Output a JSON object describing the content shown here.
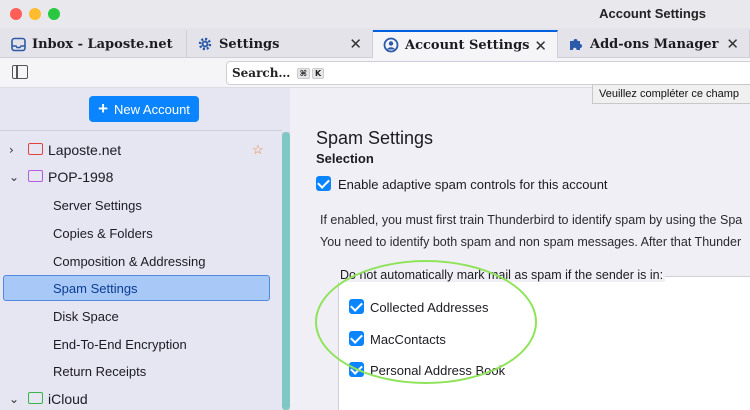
{
  "window": {
    "title": "Account Settings"
  },
  "tabs": [
    {
      "label": "Inbox - Laposte.net",
      "icon": "inbox-icon",
      "closable": false,
      "active": false
    },
    {
      "label": "Settings",
      "icon": "gear-icon",
      "closable": true,
      "active": false
    },
    {
      "label": "Account Settings",
      "icon": "account-settings-icon",
      "closable": true,
      "active": true
    },
    {
      "label": "Add-ons Manager",
      "icon": "puzzle-icon",
      "closable": true,
      "active": false
    }
  ],
  "toolbar": {
    "search_placeholder": "Search…",
    "shortcut_keys": [
      "⌘",
      "K"
    ],
    "tooltip": "Veuillez compléter ce champ"
  },
  "sidebar": {
    "new_account_label": "New Account",
    "accounts": [
      {
        "label": "Laposte.net",
        "expanded": false,
        "starred": true,
        "icon_color": "#e0443e"
      },
      {
        "label": "POP-1998",
        "expanded": true,
        "starred": false,
        "icon_color": "#b45be0",
        "items": [
          {
            "label": "Server Settings"
          },
          {
            "label": "Copies & Folders"
          },
          {
            "label": "Composition & Addressing"
          },
          {
            "label": "Spam Settings",
            "selected": true
          },
          {
            "label": "Disk Space"
          },
          {
            "label": "End-To-End Encryption"
          },
          {
            "label": "Return Receipts"
          }
        ]
      },
      {
        "label": "iCloud",
        "expanded": true,
        "starred": false,
        "icon_color": "#3bb54a"
      }
    ]
  },
  "main": {
    "title": "Spam Settings",
    "section": "Selection",
    "adaptive_checkbox": {
      "label": "Enable adaptive spam controls for this account",
      "checked": true
    },
    "info_lines": [
      "If enabled, you must first train Thunderbird to identify spam by using the Spa",
      "You need to identify both spam and non spam messages. After that Thunder"
    ],
    "exclude_label": "Do not automatically mark mail as spam if the sender is in:",
    "address_books": [
      {
        "label": "Collected Addresses",
        "checked": true
      },
      {
        "label": "MacContacts",
        "checked": true
      },
      {
        "label": "Personal Address Book",
        "checked": true
      }
    ]
  },
  "colors": {
    "accent": "#0a84ff",
    "highlight": "#8fe35a",
    "selected_bg": "#a8c8f8"
  }
}
